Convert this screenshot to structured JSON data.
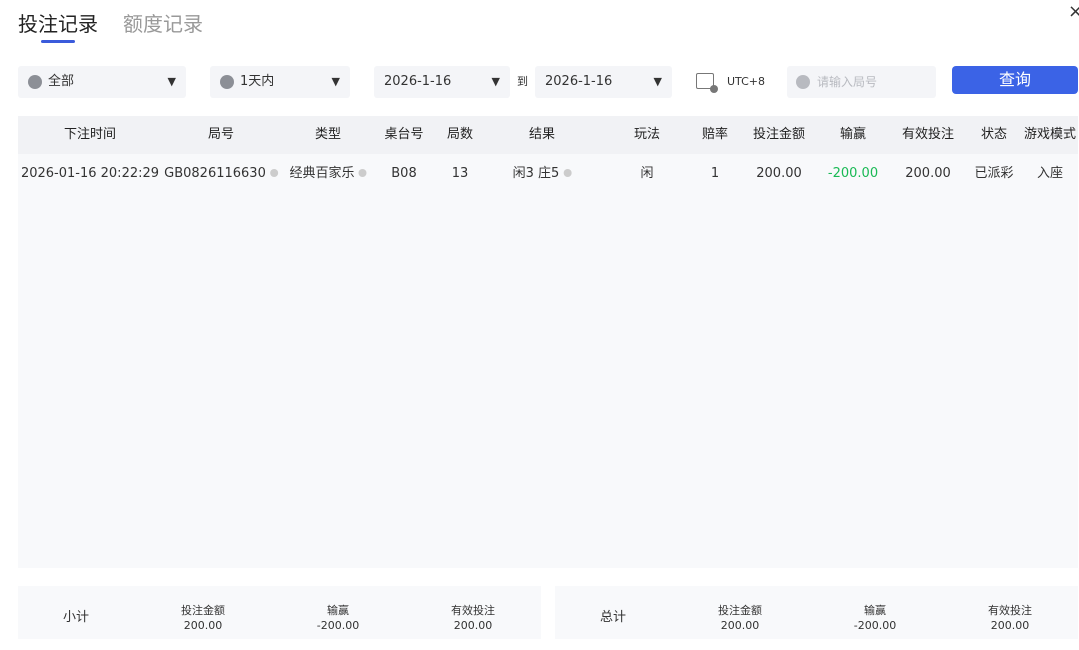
{
  "tabs": {
    "bet_records": "投注记录",
    "credit_records": "额度记录"
  },
  "close_glyph": "×",
  "filters": {
    "game_type": "全部",
    "time_range": "1天内",
    "date_from": "2026-1-16",
    "to_label": "到",
    "date_to": "2026-1-16",
    "timezone": "UTC+8",
    "round_placeholder": "请输入局号",
    "query_label": "查询",
    "caret": "▼"
  },
  "table": {
    "headers": [
      "下注时间",
      "局号",
      "类型",
      "桌台号",
      "局数",
      "结果",
      "玩法",
      "赔率",
      "投注金额",
      "输赢",
      "有效投注",
      "状态",
      "游戏模式"
    ],
    "rows": [
      {
        "time": "2026-01-16 20:22:29",
        "round_id": "GB0826116630",
        "type": "经典百家乐",
        "table_no": "B08",
        "round_count": "13",
        "result": "闲3 庄5",
        "play": "闲",
        "odds": "1",
        "bet_amount": "200.00",
        "win_loss": "-200.00",
        "valid_bet": "200.00",
        "status": "已派彩",
        "mode": "入座"
      }
    ]
  },
  "subtotal": {
    "label": "小计",
    "bet_label": "投注金额",
    "bet": "200.00",
    "win_label": "输赢",
    "win": "-200.00",
    "valid_label": "有效投注",
    "valid": "200.00"
  },
  "total": {
    "label": "总计",
    "bet_label": "投注金额",
    "bet": "200.00",
    "win_label": "输赢",
    "win": "-200.00",
    "valid_label": "有效投注",
    "valid": "200.00"
  },
  "colors": {
    "accent": "#3b63e6",
    "loss": "#19b954"
  }
}
